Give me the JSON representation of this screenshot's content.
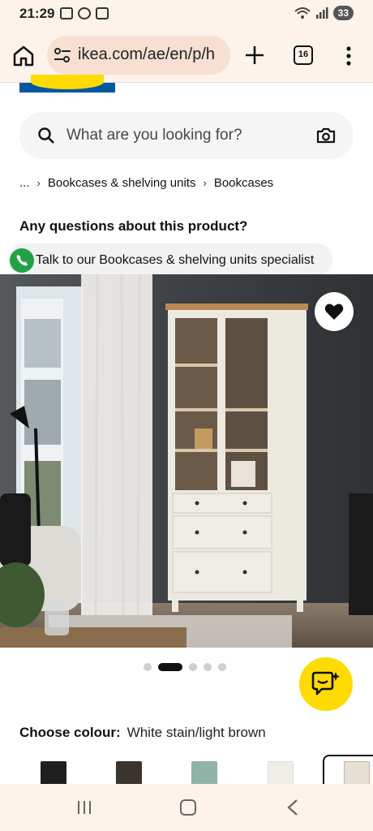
{
  "status_bar": {
    "time": "21:29",
    "battery": "33"
  },
  "browser": {
    "url": "ikea.com/ae/en/p/h",
    "tab_count": "16"
  },
  "search": {
    "placeholder": "What are you looking for?"
  },
  "breadcrumb": {
    "ellipsis": "...",
    "items": [
      "Bookcases & shelving units",
      "Bookcases"
    ]
  },
  "questions": {
    "heading": "Any questions about this product?",
    "specialist_label": "Talk to our Bookcases & shelving units specialist"
  },
  "carousel": {
    "count": 5,
    "active_index": 1
  },
  "colour": {
    "label": "Choose colour:",
    "value": "White stain/light brown"
  },
  "colors": {
    "accent": "#ffdb00",
    "brand_blue": "#0058a3",
    "chrome": "#fdf3ea",
    "call_green": "#24a148"
  },
  "icons": [
    "home-icon",
    "site-settings-icon",
    "plus-icon",
    "tabs-icon",
    "more-icon",
    "search-icon",
    "camera-icon",
    "phone-icon",
    "heart-icon",
    "chat-assistant-icon",
    "recent-apps-icon",
    "nav-home-icon",
    "back-icon"
  ]
}
